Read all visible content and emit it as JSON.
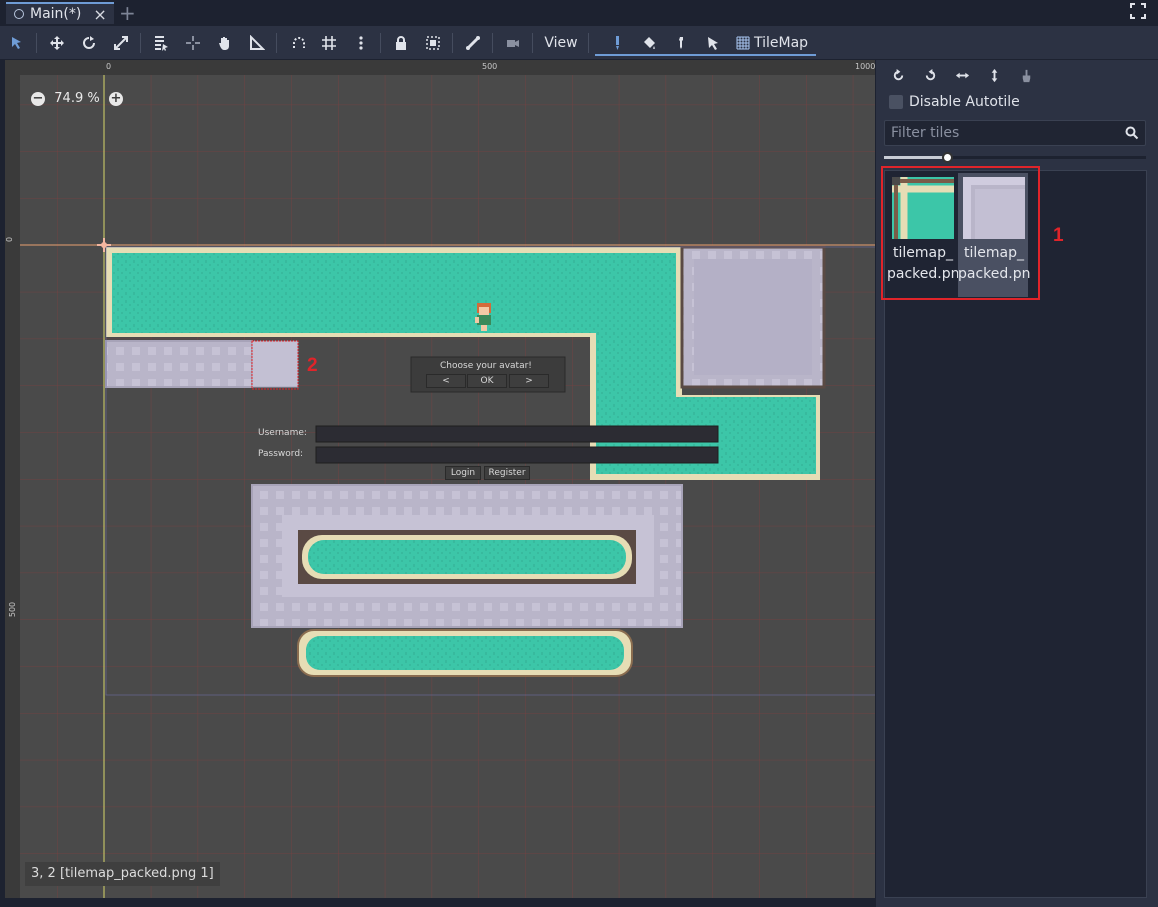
{
  "tabs": {
    "active_label": "Main(*)",
    "close_icon": "×",
    "add_icon": "+"
  },
  "toolbar": {
    "view_label": "View",
    "tilemap_label": "TileMap"
  },
  "viewport": {
    "zoom_label": "74.9 %",
    "ruler_top": [
      "0",
      "500",
      "1000"
    ],
    "ruler_left": [
      "0",
      "500"
    ],
    "status": "3, 2 [tilemap_packed.png 1]",
    "scene_gui": {
      "avatar_title": "Choose your avatar!",
      "prev_btn": "<",
      "ok_btn": "OK",
      "next_btn": ">",
      "username_label": "Username:",
      "password_label": "Password:",
      "login_btn": "Login",
      "register_btn": "Register"
    },
    "annotation_2": "2"
  },
  "panel": {
    "disable_autotile_label": "Disable Autotile",
    "filter_placeholder": "Filter tiles",
    "tiles": [
      {
        "caption_line1": "tilemap_",
        "caption_line2": "packed.pn"
      },
      {
        "caption_line1": "tilemap_",
        "caption_line2": "packed.pn"
      }
    ],
    "annotation_1": "1"
  },
  "colors": {
    "accent": "#6f9cd6",
    "water": "#3cc6a8",
    "stone": "#b8b4c8",
    "annotation": "#e0242a"
  }
}
